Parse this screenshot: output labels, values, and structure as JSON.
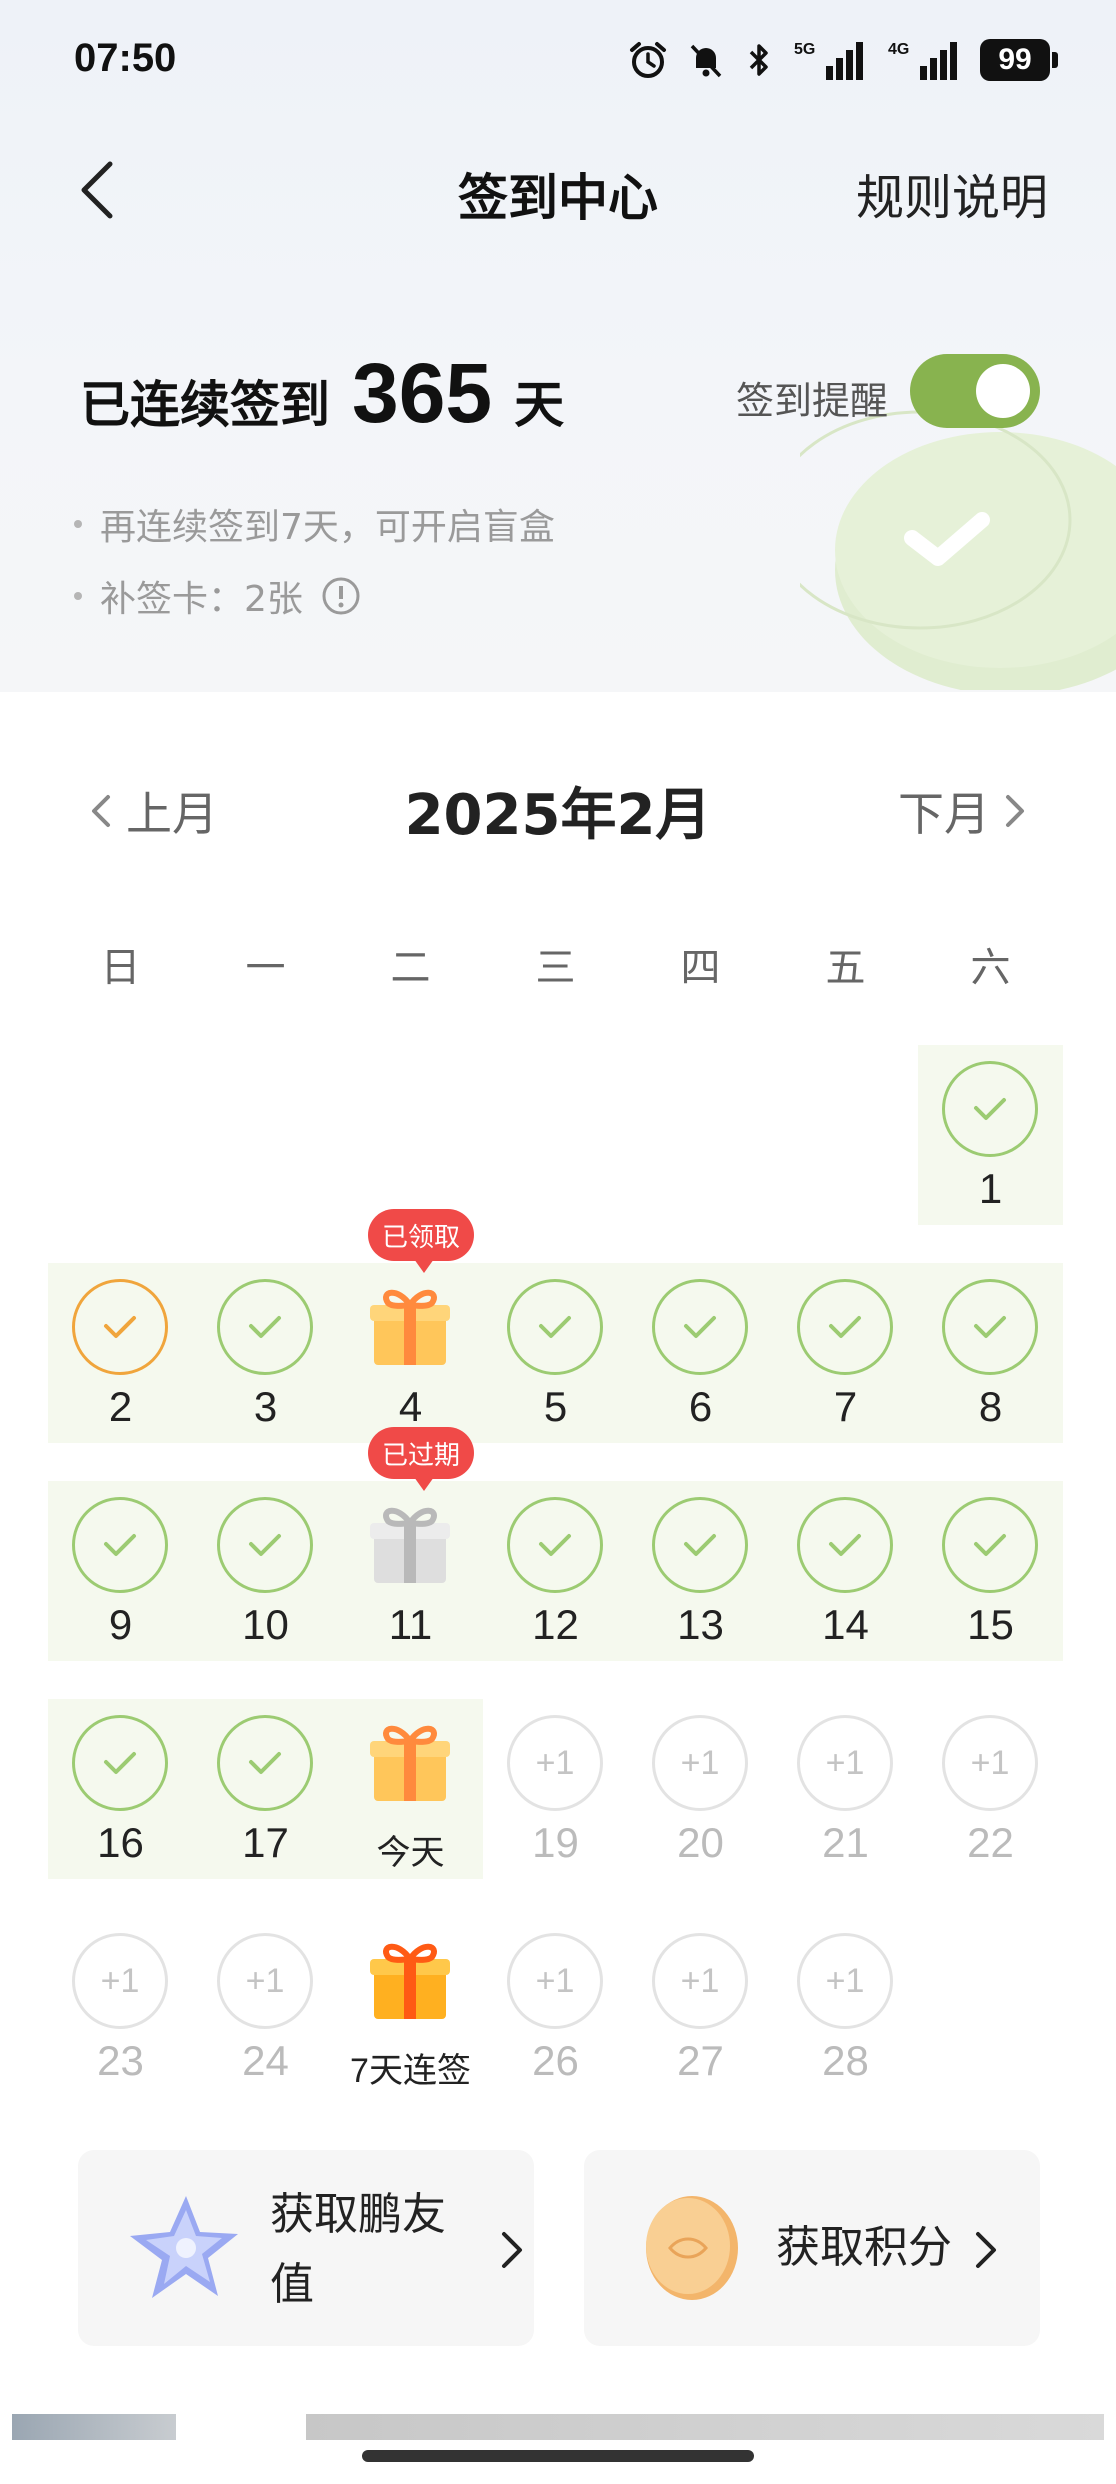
{
  "status_bar": {
    "time": "07:50",
    "battery": "99",
    "network_1": "5G",
    "network_2": "4G"
  },
  "nav": {
    "title": "签到中心",
    "rules_label": "规则说明"
  },
  "streak": {
    "prefix": "已连续签到",
    "days": "365",
    "unit": "天"
  },
  "reminder": {
    "label": "签到提醒",
    "enabled": true
  },
  "tips": [
    "再连续签到7天，可开启盲盒",
    "补签卡：2张"
  ],
  "month_nav": {
    "prev": "上月",
    "title": "2025年2月",
    "next": "下月"
  },
  "weekdays": [
    "日",
    "一",
    "二",
    "三",
    "四",
    "五",
    "六"
  ],
  "calendar": {
    "badges": {
      "claimed": "已领取",
      "expired": "已过期"
    },
    "day_labels": {
      "d1": "1",
      "d2": "2",
      "d3": "3",
      "d4": "4",
      "d5": "5",
      "d6": "6",
      "d7": "7",
      "d8": "8",
      "d9": "9",
      "d10": "10",
      "d11": "11",
      "d12": "12",
      "d13": "13",
      "d14": "14",
      "d15": "15",
      "d16": "16",
      "d17": "17",
      "today": "今天",
      "d19": "19",
      "d20": "20",
      "d21": "21",
      "d22": "22",
      "d23": "23",
      "d24": "24",
      "streak7": "7天连签",
      "d26": "26",
      "d27": "27",
      "d28": "28"
    },
    "future_reward": "+1"
  },
  "cards": {
    "left": {
      "label": "获取鹏友值"
    },
    "right": {
      "label": "获取积分"
    }
  },
  "colors": {
    "check_green": "#9ccb72",
    "toggle_green": "#88b34f",
    "badge_red": "#f04a48",
    "missed_orange": "#f0a53c",
    "signed_row_bg": "#f5f9ee"
  }
}
